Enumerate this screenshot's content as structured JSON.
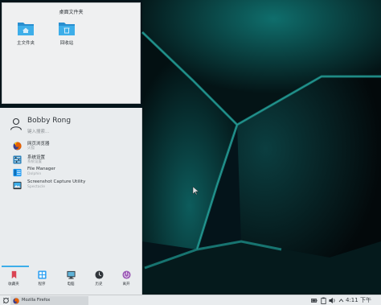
{
  "desktop_folder": {
    "title": "桌面文件夹",
    "items": [
      {
        "label": "主文件夹",
        "icon": "home-folder-icon"
      },
      {
        "label": "回收站",
        "icon": "trash-folder-icon"
      }
    ]
  },
  "launcher": {
    "user_name": "Bobby Rong",
    "search_placeholder": "键入搜索...",
    "favorites": [
      {
        "name": "网页浏览器",
        "desc": "火狐",
        "icon": "firefox-icon"
      },
      {
        "name": "系统设置",
        "desc": "系统设置",
        "icon": "system-settings-icon"
      },
      {
        "name": "File Manager",
        "desc": "Dolphin",
        "icon": "file-manager-icon"
      },
      {
        "name": "Screenshot Capture Utility",
        "desc": "Spectacle",
        "icon": "screenshot-icon"
      }
    ],
    "tabs": [
      {
        "label": "收藏夹",
        "icon": "bookmark-icon",
        "active": true
      },
      {
        "label": "程序",
        "icon": "applications-icon",
        "active": false
      },
      {
        "label": "电脑",
        "icon": "computer-icon",
        "active": false
      },
      {
        "label": "历史",
        "icon": "history-icon",
        "active": false
      },
      {
        "label": "离开",
        "icon": "leave-icon",
        "active": false
      }
    ]
  },
  "taskbar": {
    "tasks": [
      {
        "label": "Mozilla Firefox",
        "icon": "firefox-icon"
      }
    ],
    "tray_icons": [
      "battery-icon",
      "clipboard-icon",
      "volume-icon",
      "chevron-up-icon"
    ],
    "clock": "4:11 下午"
  },
  "colors": {
    "accent": "#3daee9",
    "panel_bg": "#e9ecee",
    "text": "#31363b",
    "wallpaper_teal": "#0e5b5c"
  }
}
